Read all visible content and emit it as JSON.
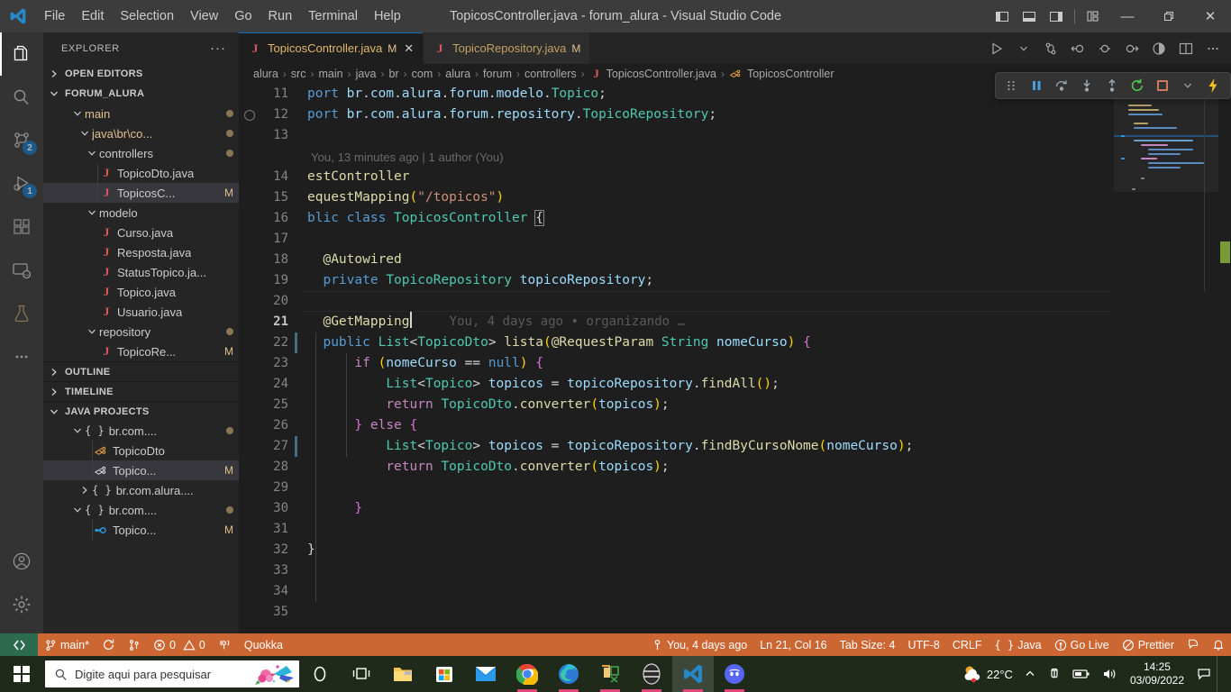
{
  "window": {
    "title": "TopicosController.java - forum_alura - Visual Studio Code",
    "menu": [
      "File",
      "Edit",
      "Selection",
      "View",
      "Go",
      "Run",
      "Terminal",
      "Help"
    ],
    "controls": {
      "minimize": "—",
      "restore": "❐",
      "close": "✕"
    },
    "layout_icons": [
      "panel-left-icon",
      "panel-bottom-icon",
      "panel-right-icon",
      "customize-layout-icon"
    ]
  },
  "activitybar": {
    "items": [
      {
        "name": "explorer-icon",
        "badge": ""
      },
      {
        "name": "search-icon",
        "badge": ""
      },
      {
        "name": "source-control-icon",
        "badge": "2"
      },
      {
        "name": "run-and-debug-icon",
        "badge": "1"
      },
      {
        "name": "extensions-icon",
        "badge": ""
      },
      {
        "name": "remote-explorer-icon",
        "badge": ""
      },
      {
        "name": "testing-icon",
        "badge": ""
      },
      {
        "name": "more-actions-icon",
        "badge": ""
      }
    ],
    "bottom": [
      {
        "name": "accounts-icon"
      },
      {
        "name": "manage-settings-icon"
      }
    ]
  },
  "sidebar": {
    "title": "EXPLORER",
    "more_label": "···",
    "sections": [
      {
        "label": "OPEN EDITORS",
        "expanded": false
      },
      {
        "label": "FORUM_ALURA",
        "expanded": true
      },
      {
        "label": "OUTLINE",
        "expanded": false
      },
      {
        "label": "TIMELINE",
        "expanded": false
      },
      {
        "label": "JAVA PROJECTS",
        "expanded": true
      }
    ],
    "tree": [
      {
        "label": "main",
        "type": "folder",
        "indent": 2,
        "expanded": true,
        "dot": true
      },
      {
        "label": "java\\br\\co...",
        "type": "folder",
        "indent": 3,
        "expanded": true,
        "dot": true
      },
      {
        "label": "controllers",
        "type": "folder",
        "indent": 4,
        "expanded": true,
        "dot": true
      },
      {
        "label": "TopicoDto.java",
        "type": "java",
        "indent": 5,
        "badge": ""
      },
      {
        "label": "TopicosC...",
        "type": "java",
        "indent": 5,
        "badge": "M",
        "selected": true
      },
      {
        "label": "modelo",
        "type": "folder",
        "indent": 4,
        "expanded": true
      },
      {
        "label": "Curso.java",
        "type": "java",
        "indent": 5,
        "badge": ""
      },
      {
        "label": "Resposta.java",
        "type": "java",
        "indent": 5,
        "badge": ""
      },
      {
        "label": "StatusTopico.ja...",
        "type": "java",
        "indent": 5,
        "badge": ""
      },
      {
        "label": "Topico.java",
        "type": "java",
        "indent": 5,
        "badge": ""
      },
      {
        "label": "Usuario.java",
        "type": "java",
        "indent": 5,
        "badge": ""
      },
      {
        "label": "repository",
        "type": "folder",
        "indent": 4,
        "expanded": true,
        "dot": true
      },
      {
        "label": "TopicoRe...",
        "type": "java",
        "indent": 5,
        "badge": "M"
      }
    ],
    "java_projects": [
      {
        "label": "br.com....",
        "type": "package",
        "indent": 3,
        "expanded": true,
        "dot": true
      },
      {
        "label": "TopicoDto",
        "type": "class",
        "indent": 4,
        "badge": ""
      },
      {
        "label": "Topico...",
        "type": "class",
        "indent": 4,
        "badge": "M",
        "selected": true
      },
      {
        "label": "br.com.alura....",
        "type": "package",
        "indent": 3,
        "expanded": false
      },
      {
        "label": "br.com....",
        "type": "package",
        "indent": 3,
        "expanded": true,
        "dot": true
      },
      {
        "label": "Topico...",
        "type": "interface",
        "indent": 4,
        "badge": "M"
      }
    ]
  },
  "tabs": [
    {
      "label": "TopicosController.java",
      "icon": "java-icon",
      "modified": "M",
      "active": true,
      "closable": true
    },
    {
      "label": "TopicoRepository.java",
      "icon": "java-icon",
      "modified": "M",
      "active": false,
      "closable": false
    }
  ],
  "tab_actions": [
    "run-icon",
    "chevron-down-icon",
    "split-editor-down-icon",
    "go-back-icon",
    "go-previous-icon",
    "go-next-icon",
    "coverage-icon",
    "split-editor-icon",
    "more-actions-icon"
  ],
  "breadcrumbs": [
    "alura",
    "src",
    "main",
    "java",
    "br",
    "com",
    "alura",
    "forum",
    "controllers",
    "TopicosController.java",
    "TopicosController"
  ],
  "editor": {
    "first_line": 11,
    "blame_lens": "You, 13 minutes ago | 1 author (You)",
    "inline_blame": "You, 4 days ago • organizando …",
    "lines": [
      {
        "n": 11,
        "text": "port br.com.alura.forum.modelo.Topico;"
      },
      {
        "n": 12,
        "text": "port br.com.alura.forum.repository.TopicoRepository;",
        "breakpoint_ring": true
      },
      {
        "n": 13,
        "text": ""
      },
      {
        "n": 14,
        "text": "estController"
      },
      {
        "n": 15,
        "text": "equestMapping(\"/topicos\")"
      },
      {
        "n": 16,
        "text": "blic class TopicosController {"
      },
      {
        "n": 17,
        "text": ""
      },
      {
        "n": 18,
        "text": "  @Autowired"
      },
      {
        "n": 19,
        "text": "  private TopicoRepository topicoRepository;"
      },
      {
        "n": 20,
        "text": ""
      },
      {
        "n": 21,
        "text": "  @GetMapping",
        "current": true
      },
      {
        "n": 22,
        "text": "  public List<TopicoDto> lista(@RequestParam String nomeCurso) {",
        "changed": true
      },
      {
        "n": 23,
        "text": "      if (nomeCurso == null) {"
      },
      {
        "n": 24,
        "text": "          List<Topico> topicos = topicoRepository.findAll();"
      },
      {
        "n": 25,
        "text": "          return TopicoDto.converter(topicos);"
      },
      {
        "n": 26,
        "text": "      } else {"
      },
      {
        "n": 27,
        "text": "          List<Topico> topicos = topicoRepository.findByCursoNome(nomeCurso);",
        "changed": true
      },
      {
        "n": 28,
        "text": "          return TopicoDto.converter(topicos);"
      },
      {
        "n": 29,
        "text": ""
      },
      {
        "n": 30,
        "text": "      }"
      },
      {
        "n": 31,
        "text": ""
      },
      {
        "n": 32,
        "text": "}"
      },
      {
        "n": 33,
        "text": ""
      },
      {
        "n": 34,
        "text": ""
      },
      {
        "n": 35,
        "text": ""
      }
    ]
  },
  "debug_toolbar": {
    "buttons": [
      "drag-handle-icon",
      "pause-icon",
      "step-over-icon",
      "step-into-icon",
      "step-out-icon",
      "restart-icon",
      "stop-icon",
      "chevron-down-icon",
      "lightning-icon"
    ]
  },
  "statusbar": {
    "remote_icon": "remote-window-icon",
    "left": [
      {
        "icon": "source-control-icon",
        "label": "main*"
      },
      {
        "icon": "sync-icon",
        "label": ""
      },
      {
        "icon": "branch-icon",
        "label": ""
      },
      {
        "icon": "error-icon",
        "label": "0",
        "icon2": "warning-icon",
        "label2": "0"
      },
      {
        "icon": "radio-tower-icon",
        "label": ""
      },
      {
        "icon": "",
        "label": "Quokka"
      }
    ],
    "right": [
      {
        "icon": "git-commit-icon",
        "label": "You, 4 days ago"
      },
      {
        "icon": "",
        "label": "Ln 21, Col 16"
      },
      {
        "icon": "",
        "label": "Tab Size: 4"
      },
      {
        "icon": "",
        "label": "UTF-8"
      },
      {
        "icon": "",
        "label": "CRLF"
      },
      {
        "icon": "braces-icon",
        "label": "Java"
      },
      {
        "icon": "broadcast-icon",
        "label": "Go Live"
      },
      {
        "icon": "prettier-icon",
        "label": "Prettier"
      },
      {
        "icon": "feedback-icon",
        "label": ""
      },
      {
        "icon": "bell-icon",
        "label": ""
      }
    ]
  },
  "taskbar": {
    "search_placeholder": "Digite aqui para pesquisar",
    "apps": [
      {
        "name": "cortana-icon"
      },
      {
        "name": "task-view-icon"
      },
      {
        "name": "file-explorer-icon"
      },
      {
        "name": "microsoft-store-icon"
      },
      {
        "name": "mail-icon"
      },
      {
        "name": "chrome-icon",
        "running": true
      },
      {
        "name": "edge-icon",
        "running": true
      },
      {
        "name": "xsplit-icon",
        "running": true
      },
      {
        "name": "obs-icon",
        "running": true
      },
      {
        "name": "vscode-icon",
        "running": true,
        "active": true
      },
      {
        "name": "discord-icon",
        "running": true
      }
    ],
    "weather": "22°C",
    "tray": [
      "chevron-up-icon",
      "onedrive-icon",
      "battery-icon",
      "volume-icon"
    ],
    "time": "14:25",
    "date": "03/09/2022"
  },
  "colors": {
    "accent_statusbar": "#cc6633",
    "titlebar": "#3c3c3c",
    "sidebar": "#252526",
    "editor": "#1e1e1e",
    "activitybar": "#333333",
    "badge": "#0e70c0",
    "modified": "#e2c08d"
  }
}
